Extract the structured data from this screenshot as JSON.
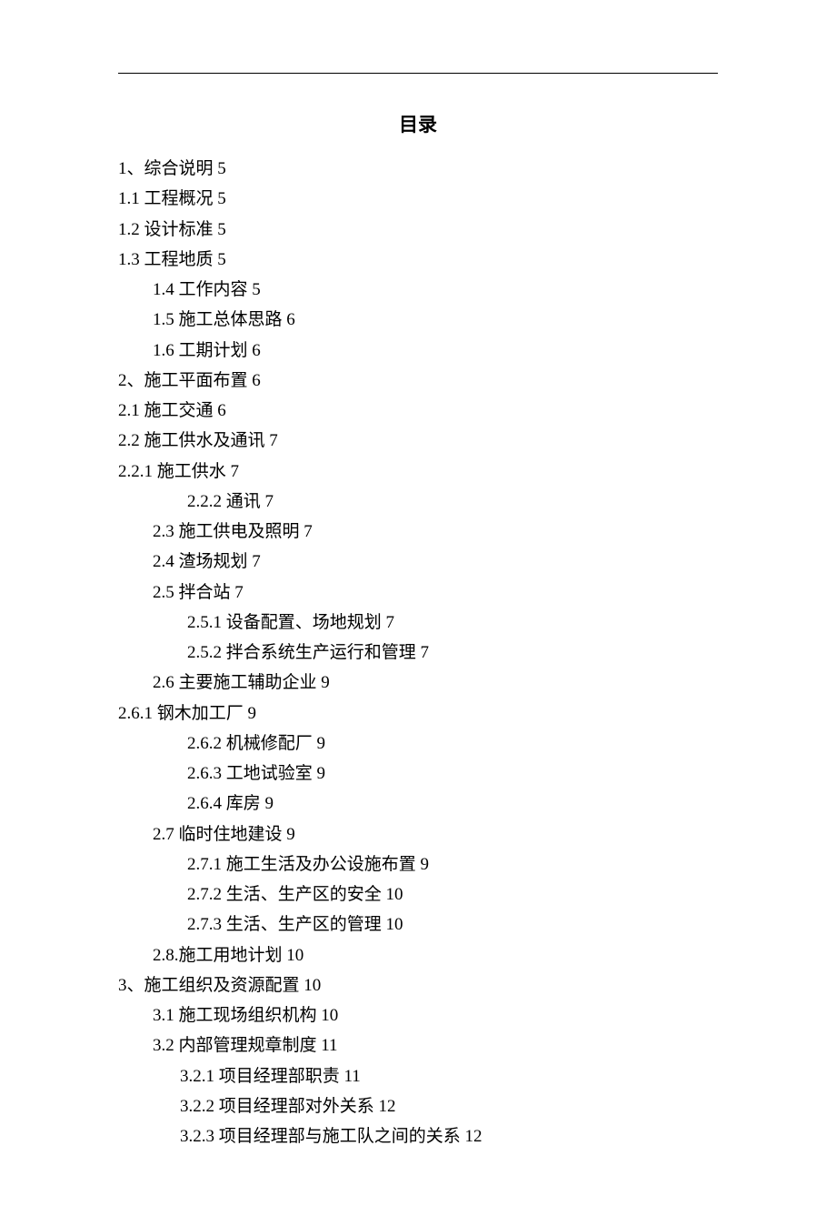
{
  "title": "目录",
  "toc": [
    {
      "indent": 0,
      "text": "1、综合说明 5"
    },
    {
      "indent": 0,
      "text": "1.1 工程概况 5"
    },
    {
      "indent": 0,
      "text": "1.2 设计标准 5"
    },
    {
      "indent": 0,
      "text": "1.3 工程地质 5"
    },
    {
      "indent": 1,
      "text": "1.4 工作内容 5"
    },
    {
      "indent": 1,
      "text": "1.5 施工总体思路 6"
    },
    {
      "indent": 1,
      "text": "1.6 工期计划 6"
    },
    {
      "indent": 0,
      "text": "2、施工平面布置 6"
    },
    {
      "indent": 0,
      "text": "2.1 施工交通 6"
    },
    {
      "indent": 0,
      "text": "2.2 施工供水及通讯 7"
    },
    {
      "indent": 0,
      "text": "2.2.1 施工供水 7"
    },
    {
      "indent": 2,
      "text": "2.2.2 通讯 7"
    },
    {
      "indent": 1,
      "text": "2.3 施工供电及照明 7"
    },
    {
      "indent": 1,
      "text": "2.4 渣场规划 7"
    },
    {
      "indent": 1,
      "text": "2.5 拌合站 7"
    },
    {
      "indent": 2,
      "text": "2.5.1 设备配置、场地规划 7"
    },
    {
      "indent": 2,
      "text": "2.5.2 拌合系统生产运行和管理 7"
    },
    {
      "indent": 1,
      "text": "2.6 主要施工辅助企业 9"
    },
    {
      "indent": 0,
      "text": "2.6.1 钢木加工厂 9"
    },
    {
      "indent": 2,
      "text": "2.6.2 机械修配厂 9"
    },
    {
      "indent": 2,
      "text": "2.6.3 工地试验室 9"
    },
    {
      "indent": 2,
      "text": "2.6.4 库房 9"
    },
    {
      "indent": 1,
      "text": "2.7 临时住地建设 9"
    },
    {
      "indent": 2,
      "text": "2.7.1 施工生活及办公设施布置 9"
    },
    {
      "indent": 2,
      "text": "2.7.2 生活、生产区的安全 10"
    },
    {
      "indent": 2,
      "text": "2.7.3 生活、生产区的管理 10"
    },
    {
      "indent": 1,
      "text": "2.8.施工用地计划 10"
    },
    {
      "indent": 0,
      "text": "3、施工组织及资源配置 10"
    },
    {
      "indent": 1,
      "text": "3.1 施工现场组织机构 10"
    },
    {
      "indent": 1,
      "text": "3.2 内部管理规章制度 11"
    },
    {
      "indent": 3,
      "text": "3.2.1 项目经理部职责 11"
    },
    {
      "indent": 3,
      "text": "3.2.2 项目经理部对外关系 12"
    },
    {
      "indent": 3,
      "text": "3.2.3 项目经理部与施工队之间的关系 12"
    }
  ]
}
